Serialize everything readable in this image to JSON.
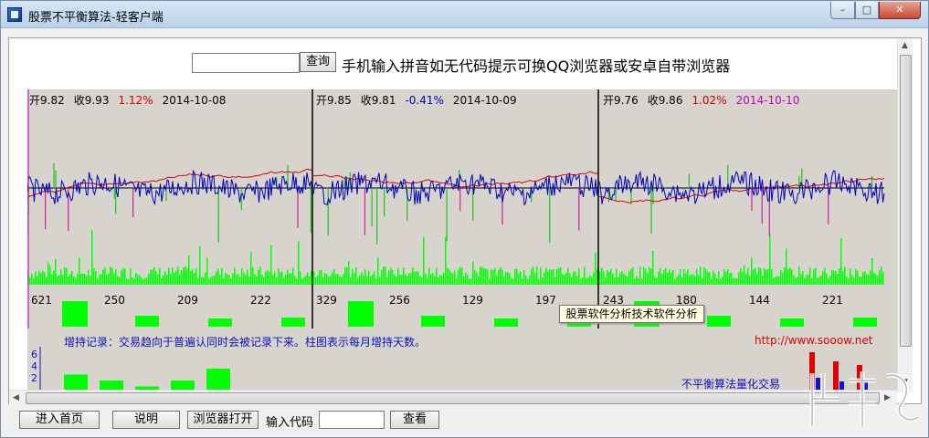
{
  "window": {
    "title": "股票不平衡算法-轻客户端",
    "controls": {
      "minimize": "–",
      "maximize": "□",
      "close": "✕"
    }
  },
  "search": {
    "input_value": "",
    "button_label": "查询",
    "tip": "手机输入拼音如无代码提示可换QQ浏览器或安卓自带浏览器"
  },
  "panels": [
    {
      "open": "开9.82",
      "close": "收9.93",
      "change": "1.12%",
      "change_color": "#d00000",
      "date": "2014-10-08",
      "date_color": "#000000",
      "volume_labels": [
        "621",
        "250",
        "209",
        "222"
      ]
    },
    {
      "open": "开9.85",
      "close": "收9.81",
      "change": "-0.41%",
      "change_color": "#0000c0",
      "date": "2014-10-09",
      "date_color": "#000000",
      "volume_labels": [
        "329",
        "256",
        "129",
        "197"
      ]
    },
    {
      "open": "开9.76",
      "close": "收9.86",
      "change": "1.02%",
      "change_color": "#d00000",
      "date": "2014-10-10",
      "date_color": "#c000c0",
      "volume_labels": [
        "243",
        "180",
        "144",
        "221"
      ]
    }
  ],
  "tooltip": "股票软件分析技术软件分析",
  "record": {
    "text": "增持记录：交易趋向于普遍认同时会被记录下来。柱图表示每月增持天数。",
    "y_axis": [
      "6",
      "4",
      "2"
    ],
    "monthly_days": [
      3,
      2,
      1,
      2,
      4
    ]
  },
  "site_url": "http://www.sooow.net",
  "brand_text": "不平衡算法量化交易",
  "bottom": {
    "home": "进入首页",
    "help": "说明",
    "browser": "浏览器打开",
    "code_label": "输入代码",
    "code_value": "",
    "view": "查看"
  },
  "colors": {
    "price_line": "#0000c0",
    "avg_line": "#e00000",
    "volume": "#00ff00",
    "chart_bg": "#d6d4cc"
  }
}
